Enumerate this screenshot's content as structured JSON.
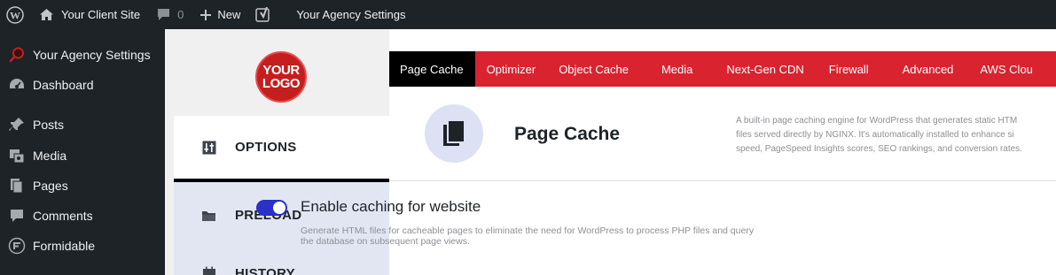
{
  "admin_bar": {
    "site_name": "Your Client Site",
    "comments_count": "0",
    "new_label": "New",
    "agency_label": "Your Agency Settings"
  },
  "sidebar": {
    "items": [
      {
        "label": "Your Agency Settings",
        "icon": "agency-search-icon"
      },
      {
        "label": "Dashboard",
        "icon": "dashboard-icon"
      },
      {
        "label": "Posts",
        "icon": "pin-icon"
      },
      {
        "label": "Media",
        "icon": "media-icon"
      },
      {
        "label": "Pages",
        "icon": "pages-icon"
      },
      {
        "label": "Comments",
        "icon": "comment-icon"
      },
      {
        "label": "Formidable",
        "icon": "formidable-icon"
      }
    ]
  },
  "logo": {
    "line1": "YOUR",
    "line2": "LOGO"
  },
  "side_tabs": [
    {
      "label": "OPTIONS",
      "icon": "options-icon"
    },
    {
      "label": "PRELOAD",
      "icon": "folder-icon"
    },
    {
      "label": "HISTORY",
      "icon": "calendar-icon"
    }
  ],
  "top_nav": [
    "Page Cache",
    "Optimizer",
    "Object Cache",
    "Media",
    "Next-Gen CDN",
    "Firewall",
    "Advanced",
    "AWS Clou"
  ],
  "header": {
    "title": "Page Cache",
    "description_lines": [
      "A built-in page caching engine for WordPress that generates static HTM",
      "files served directly by NGINX. It's automatically installed to enhance si",
      "speed, PageSpeed Insights scores, SEO rankings, and conversion rates."
    ]
  },
  "option": {
    "enabled": true,
    "title": "Enable caching for website",
    "description_line1": "Generate HTML files for cacheable pages to eliminate the need for WordPress to process PHP files and query",
    "description_line2": "the database on subsequent page views."
  },
  "colors": {
    "admin_bg": "#1d2327",
    "nav_red": "#d9232f",
    "nav_active": "#000000",
    "tab_bg": "#e2e6f3",
    "toggle": "#2b30c6",
    "logo_red": "#c41e1e"
  }
}
